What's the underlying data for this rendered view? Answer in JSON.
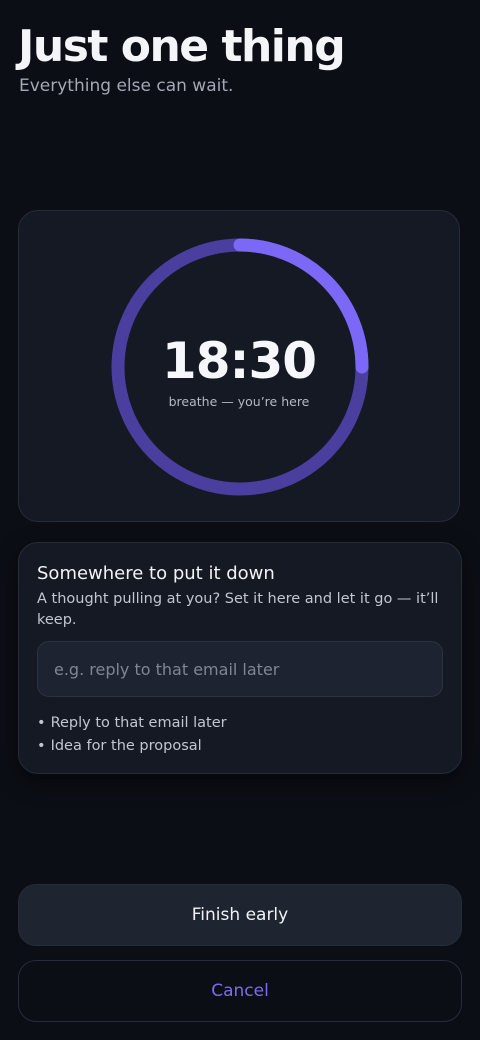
{
  "header": {
    "title": "Just one thing",
    "subtitle": "Everything else can wait."
  },
  "timer": {
    "value": "18:30",
    "caption": "breathe — you’re here",
    "progress_fraction": 0.25,
    "track_color": "#4a3f9e",
    "progress_color": "#7b68f6"
  },
  "parking_lot": {
    "heading": "Somewhere to put it down",
    "help_text": "A thought pulling at you? Set it here and let it go — it’ll keep.",
    "input": {
      "value": "",
      "placeholder": "e.g. reply to that email later"
    },
    "bullet_char": "•",
    "items": [
      "Reply to that email later",
      "Idea for the proposal"
    ]
  },
  "actions": {
    "finish_label": "Finish early",
    "cancel_label": "Cancel"
  },
  "colors": {
    "background": "#0b0e14",
    "card": "#141923",
    "accent": "#7c6cf0"
  }
}
